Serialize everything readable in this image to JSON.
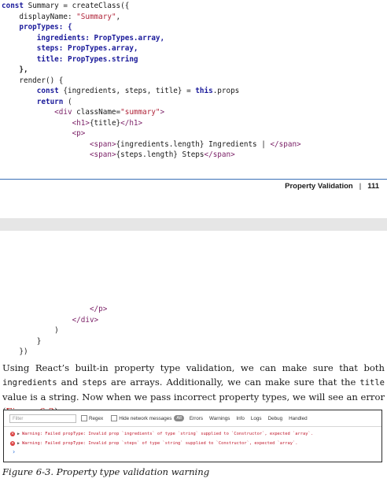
{
  "code_top": {
    "l1_kw": "const",
    "l1_rest": " Summary = createClass({",
    "l2_prop": "displayName:",
    "l2_str": "\"Summary\"",
    "l2_end": ",",
    "l3": "propTypes: {",
    "l4_a": "ingredients:",
    "l4_b": " PropTypes.array,",
    "l5_a": "steps:",
    "l5_b": " PropTypes.array,",
    "l6_a": "title:",
    "l6_b": " PropTypes.string",
    "l7": "},",
    "l8": "render() {",
    "l9_kw": "const",
    "l9_rest": " {ingredients, steps, title} = ",
    "l9_this": "this",
    "l9_end": ".props",
    "l10_kw": "return",
    "l10_rest": " (",
    "l11_tag": "<div",
    "l11_attr": " className=",
    "l11_str": "\"summary\"",
    "l11_end": ">",
    "l12_a": "<h1>",
    "l12_b": "{title}",
    "l12_c": "</h1>",
    "l13": "<p>",
    "l14_a": "<span>",
    "l14_b": "{ingredients.length} Ingredients | ",
    "l14_c": "</span>",
    "l15_a": "<span>",
    "l15_b": "{steps.length} Steps",
    "l15_c": "</span>"
  },
  "footer": {
    "section": "Property Validation",
    "separator": "|",
    "page": "111"
  },
  "code_bottom": {
    "l1": "</p>",
    "l2": "</div>",
    "l3": ")",
    "l4": "}",
    "l5": "})"
  },
  "body": {
    "t1": "Using React’s built-in property type validation, we can make sure that both ",
    "m1": "ingredi­ents",
    "t2": " and ",
    "m2": "steps",
    "t3": " are arrays. Additionally, we can make sure that the ",
    "m3": "title",
    "t4": " value is a string. Now when we pass incorrect property types, we will see an error (",
    "xref": "Figure 6-3",
    "t5": ")."
  },
  "console": {
    "filter_placeholder": "Filter",
    "regex_label": "Regex",
    "hide_network_label": "Hide network messages",
    "all_badge": "All",
    "levels": [
      "Errors",
      "Warnings",
      "Info",
      "Logs",
      "Debug",
      "Handled"
    ],
    "rows": [
      "Warning: Failed propType: Invalid prop `ingredients` of type `string` supplied to `Constructor`, expected `array`.",
      "Warning: Failed propType: Invalid prop `steps` of type `string` supplied to `Constructor`, expected `array`."
    ],
    "prompt": "›"
  },
  "caption": "Figure 6-3. Property type validation warning"
}
